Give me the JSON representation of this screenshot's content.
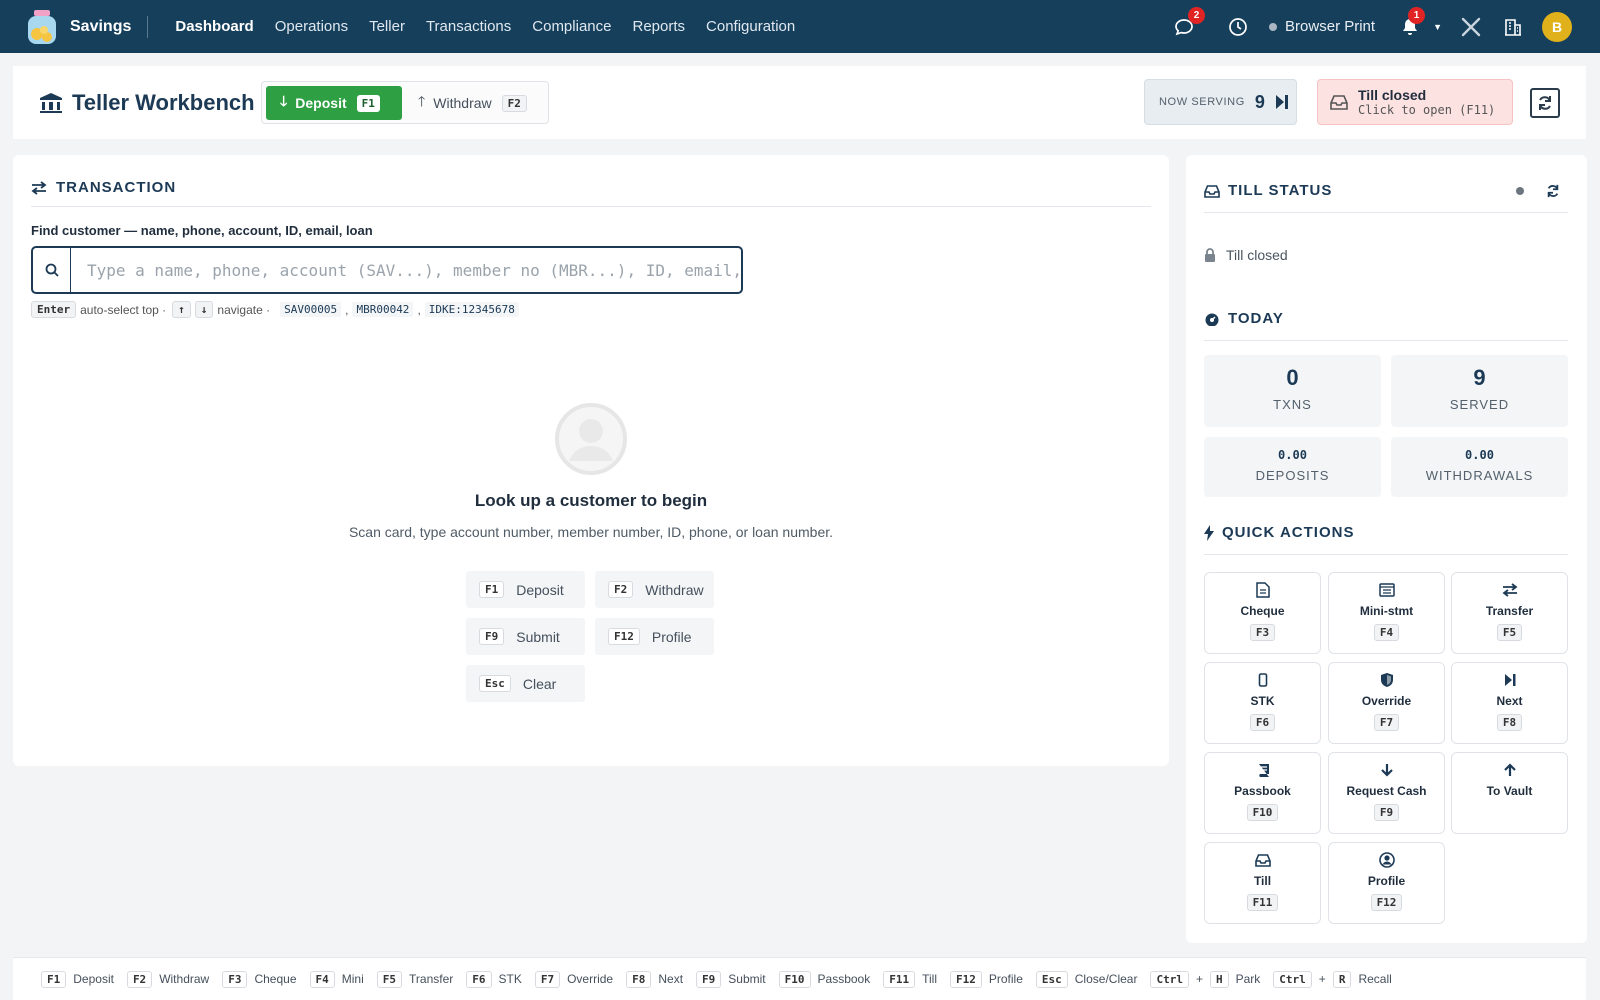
{
  "nav": {
    "app_name": "Savings",
    "links": [
      "Dashboard",
      "Operations",
      "Teller",
      "Transactions",
      "Compliance",
      "Reports",
      "Configuration"
    ],
    "chat_badge": "2",
    "notif_badge": "1",
    "printer_label": "Browser Print",
    "avatar_initial": "B"
  },
  "header": {
    "title": "Teller Workbench",
    "deposit_label": "Deposit",
    "deposit_key": "F1",
    "withdraw_label": "Withdraw",
    "withdraw_key": "F2",
    "now_serving_label": "NOW SERVING",
    "now_serving_number": "9",
    "till_title": "Till closed",
    "till_sub": "Click to open (F11)"
  },
  "transaction": {
    "title": "TRANSACTION",
    "find_label": "Find customer — name, phone, account, ID, email, loan",
    "search_placeholder": "Type a name, phone, account (SAV...), member no (MBR...), ID, email,",
    "hint_enter": "Enter",
    "hint_auto": "auto-select top ·",
    "hint_up": "↑",
    "hint_down": "↓",
    "hint_nav": "navigate ·",
    "hint_codes": [
      "SAV00005",
      "MBR00042",
      "IDKE:12345678"
    ],
    "empty_title": "Look up a customer to begin",
    "empty_sub": "Scan card, type account number, member number, ID, phone, or loan number.",
    "shortcuts": [
      {
        "key": "F1",
        "label": "Deposit"
      },
      {
        "key": "F2",
        "label": "Withdraw"
      },
      {
        "key": "F9",
        "label": "Submit"
      },
      {
        "key": "F12",
        "label": "Profile"
      },
      {
        "key": "Esc",
        "label": "Clear"
      }
    ]
  },
  "sidebar": {
    "till_title": "TILL STATUS",
    "till_state": "Till closed",
    "today_title": "TODAY",
    "stats": [
      {
        "value": "0",
        "label": "TXNS"
      },
      {
        "value": "9",
        "label": "SERVED"
      },
      {
        "value": "0.00",
        "label": "DEPOSITS"
      },
      {
        "value": "0.00",
        "label": "WITHDRAWALS"
      }
    ],
    "quick_title": "QUICK ACTIONS",
    "quick_actions": [
      {
        "label": "Cheque",
        "key": "F3",
        "icon": "document-icon"
      },
      {
        "label": "Mini-stmt",
        "key": "F4",
        "icon": "list-icon"
      },
      {
        "label": "Transfer",
        "key": "F5",
        "icon": "transfer-icon"
      },
      {
        "label": "STK",
        "key": "F6",
        "icon": "mobile-icon"
      },
      {
        "label": "Override",
        "key": "F7",
        "icon": "shield-icon"
      },
      {
        "label": "Next",
        "key": "F8",
        "icon": "skip-icon"
      },
      {
        "label": "Passbook",
        "key": "F10",
        "icon": "book-icon"
      },
      {
        "label": "Request Cash",
        "key": "F9",
        "icon": "arrow-down-icon"
      },
      {
        "label": "To Vault",
        "key": "",
        "icon": "arrow-up-icon"
      },
      {
        "label": "Till",
        "key": "F11",
        "icon": "inbox-icon"
      },
      {
        "label": "Profile",
        "key": "F12",
        "icon": "user-circle-icon"
      }
    ]
  },
  "bottom_bar": [
    {
      "keys": [
        "F1"
      ],
      "label": "Deposit"
    },
    {
      "keys": [
        "F2"
      ],
      "label": "Withdraw"
    },
    {
      "keys": [
        "F3"
      ],
      "label": "Cheque"
    },
    {
      "keys": [
        "F4"
      ],
      "label": "Mini"
    },
    {
      "keys": [
        "F5"
      ],
      "label": "Transfer"
    },
    {
      "keys": [
        "F6"
      ],
      "label": "STK"
    },
    {
      "keys": [
        "F7"
      ],
      "label": "Override"
    },
    {
      "keys": [
        "F8"
      ],
      "label": "Next"
    },
    {
      "keys": [
        "F9"
      ],
      "label": "Submit"
    },
    {
      "keys": [
        "F10"
      ],
      "label": "Passbook"
    },
    {
      "keys": [
        "F11"
      ],
      "label": "Till"
    },
    {
      "keys": [
        "F12"
      ],
      "label": "Profile"
    },
    {
      "keys": [
        "Esc"
      ],
      "label": "Close/Clear"
    },
    {
      "keys": [
        "Ctrl",
        "H"
      ],
      "label": "Park"
    },
    {
      "keys": [
        "Ctrl",
        "R"
      ],
      "label": "Recall"
    }
  ],
  "colors": {
    "nav_bg": "#163f5c",
    "accent_green": "#2ea043",
    "danger_bg": "#fde2e2",
    "badge_red": "#e02424"
  }
}
